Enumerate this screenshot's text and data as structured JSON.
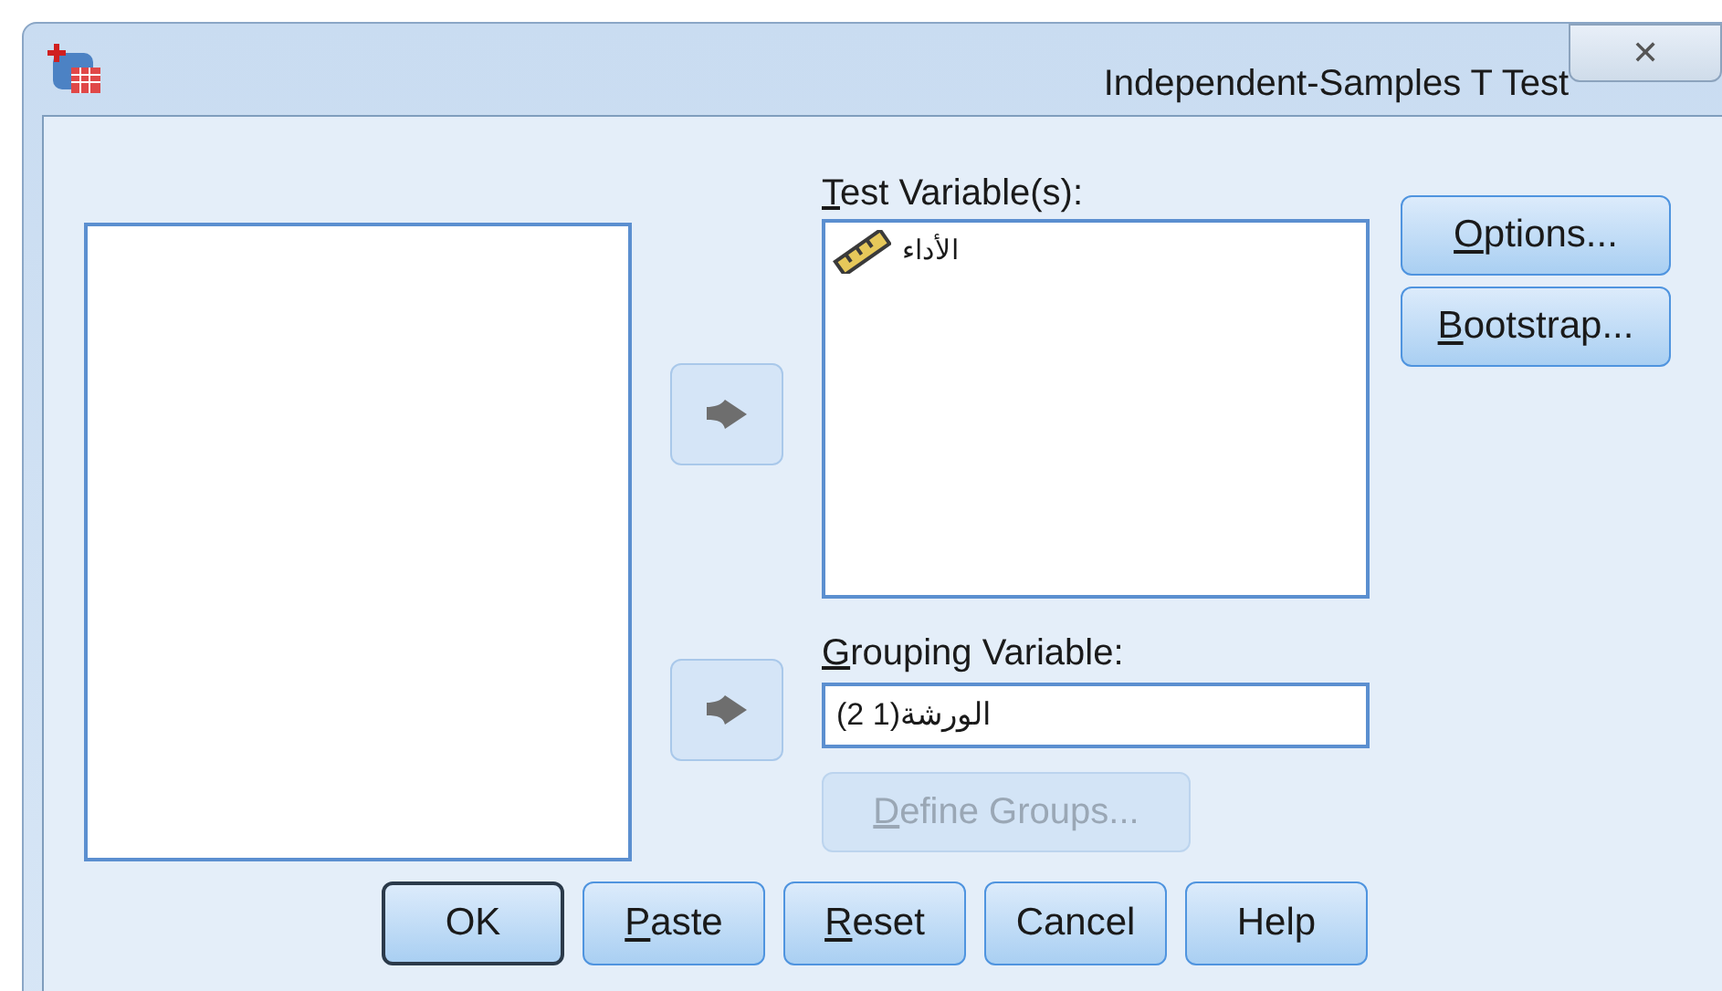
{
  "window": {
    "title": "Independent-Samples T Test",
    "close": "✕"
  },
  "test_variables": {
    "label": "Test Variable(s):",
    "mnemonic": true,
    "items": [
      {
        "name": "الأداء",
        "kind": "scale"
      }
    ]
  },
  "grouping_variable": {
    "label": "Grouping Variable:",
    "mnemonic": true,
    "value": "الورشة(1 2)"
  },
  "define_groups": {
    "label": "Define Groups...",
    "mnemonic": true,
    "disabled": true
  },
  "side_buttons": [
    {
      "label": "Options...",
      "mnemonic": true
    },
    {
      "label": "Bootstrap...",
      "mnemonic": true
    }
  ],
  "bottom_buttons": [
    {
      "label": "OK",
      "mnemonic": false,
      "default": true
    },
    {
      "label": "Paste",
      "mnemonic": true,
      "default": false
    },
    {
      "label": "Reset",
      "mnemonic": true,
      "default": false
    },
    {
      "label": "Cancel",
      "mnemonic": false,
      "default": false
    },
    {
      "label": "Help",
      "mnemonic": false,
      "default": false
    }
  ]
}
